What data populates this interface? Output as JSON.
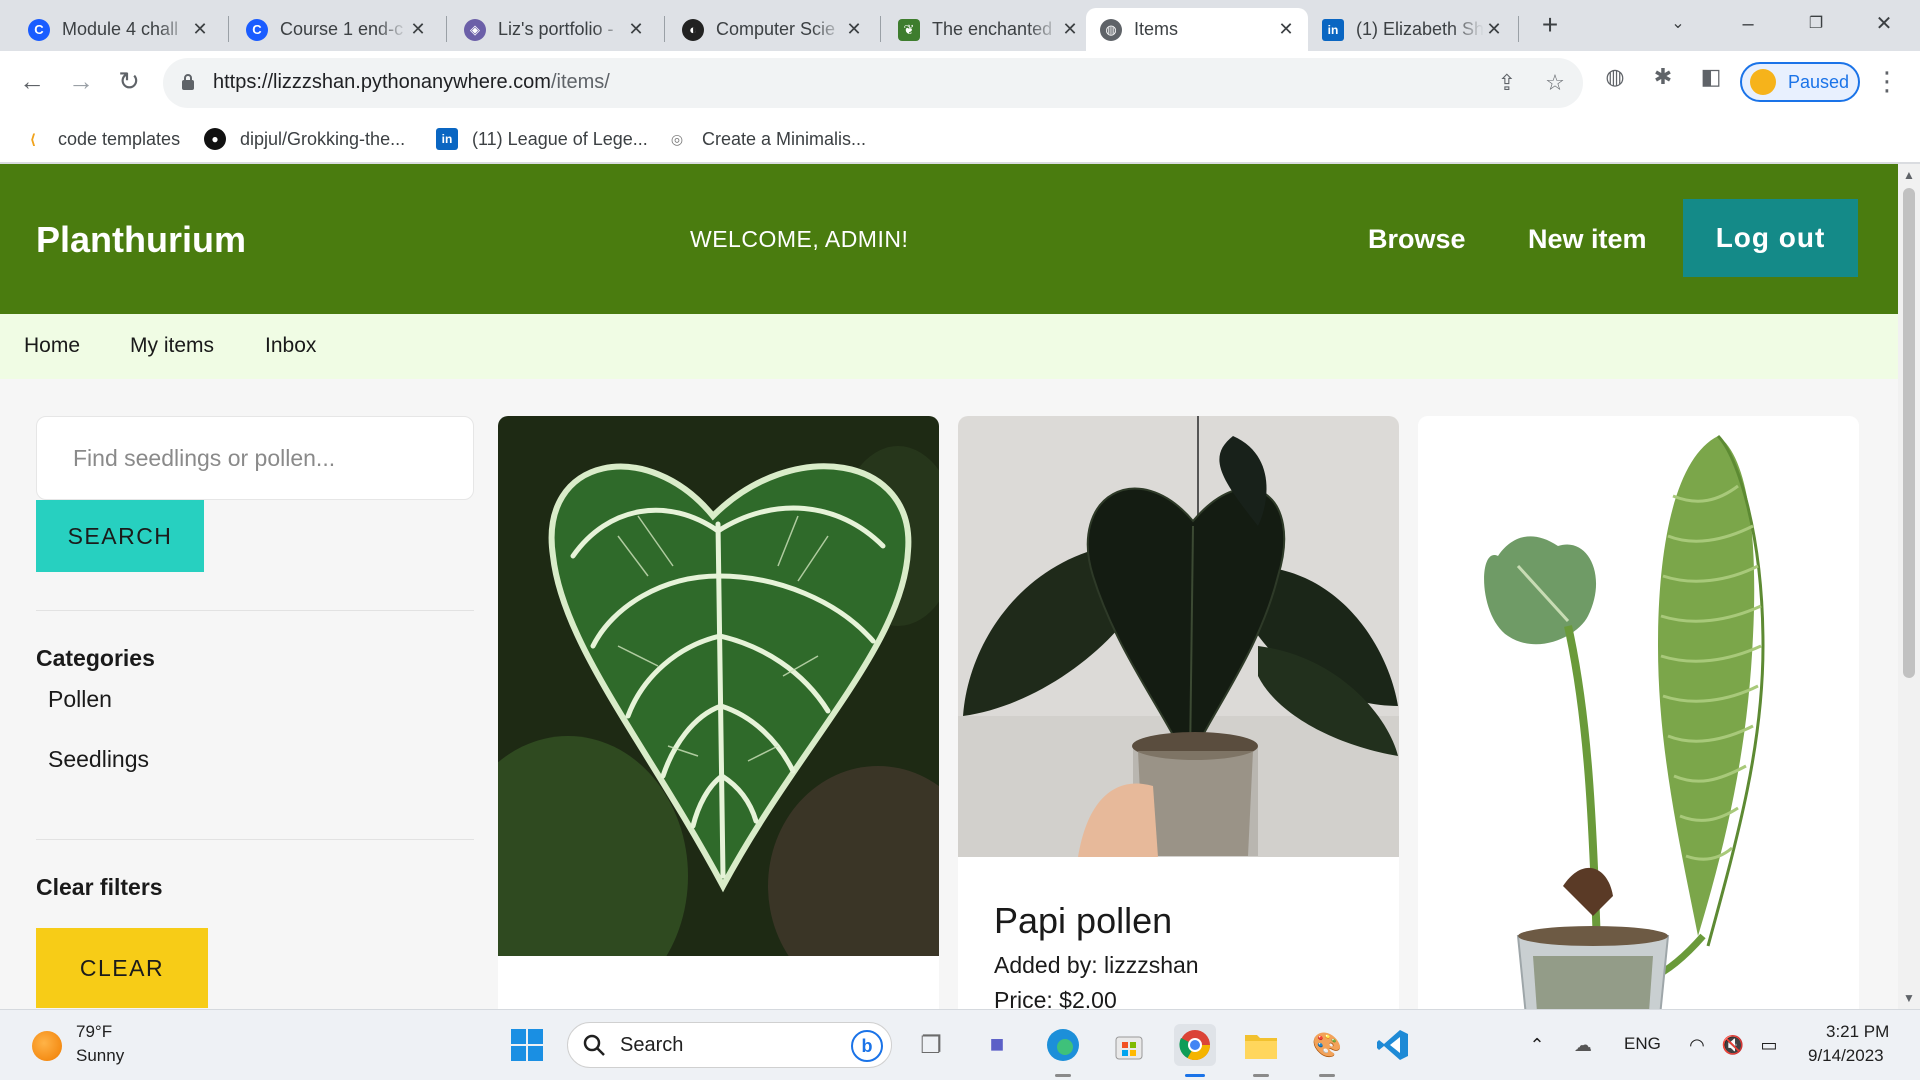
{
  "browser": {
    "tabs": [
      {
        "title": "Module 4 chall",
        "icon": "coursera-icon",
        "color": "#1a5cff"
      },
      {
        "title": "Course 1 end-c",
        "icon": "coursera-icon",
        "color": "#1a5cff"
      },
      {
        "title": "Liz's portfolio -",
        "icon": "portfolio-icon",
        "color": "#6b5fa8"
      },
      {
        "title": "Computer Scie",
        "icon": "orange-moon-icon",
        "color": "#222222"
      },
      {
        "title": "The enchanted",
        "icon": "leaf-icon",
        "color": "#3e7d2e"
      },
      {
        "title": "Items",
        "icon": "globe-icon",
        "color": "#5f6368",
        "active": true
      },
      {
        "title": "(1) Elizabeth Sh",
        "icon": "linkedin-icon",
        "color": "#0a66c2"
      }
    ],
    "url_host": "https://lizzzshan.pythonanywhere.com",
    "url_path": "/items/",
    "profile_label": "Paused",
    "bookmarks": [
      {
        "label": "code templates",
        "icon": "code-templates-icon"
      },
      {
        "label": "dipjul/Grokking-the...",
        "icon": "github-icon"
      },
      {
        "label": "(11) League of Lege...",
        "icon": "linkedin-icon"
      },
      {
        "label": "Create a Minimalis...",
        "icon": "target-icon"
      }
    ]
  },
  "site": {
    "brand": "Planthurium",
    "welcome": "WELCOME, ADMIN!",
    "nav": {
      "browse": "Browse",
      "new_item": "New item",
      "logout": "Log out"
    },
    "subnav": {
      "home": "Home",
      "my_items": "My items",
      "inbox": "Inbox"
    },
    "colors": {
      "header": "#4a7c0f",
      "logout": "#148a88",
      "search": "#27d0c0",
      "clear": "#f7cc17",
      "subnav": "#f0fce4"
    }
  },
  "sidebar": {
    "search_placeholder": "Find seedlings or pollen...",
    "search_button": "SEARCH",
    "categories_heading": "Categories",
    "categories": [
      "Pollen",
      "Seedlings"
    ],
    "clear_heading": "Clear filters",
    "clear_button": "CLEAR"
  },
  "items": [
    {
      "title": "",
      "image": "variegated-anthurium-leaf-photo"
    },
    {
      "title": "Papi pollen",
      "added_by": "Added by: lizzzshan",
      "price": "Price: $2.00",
      "image": "dark-anthurium-in-pot-photo"
    },
    {
      "title": "",
      "image": "anthurium-veitchii-in-pot-photo"
    }
  ],
  "taskbar": {
    "weather_temp": "79°F",
    "weather_cond": "Sunny",
    "search_label": "Search",
    "language": "ENG",
    "time": "3:21 PM",
    "date": "9/14/2023"
  }
}
